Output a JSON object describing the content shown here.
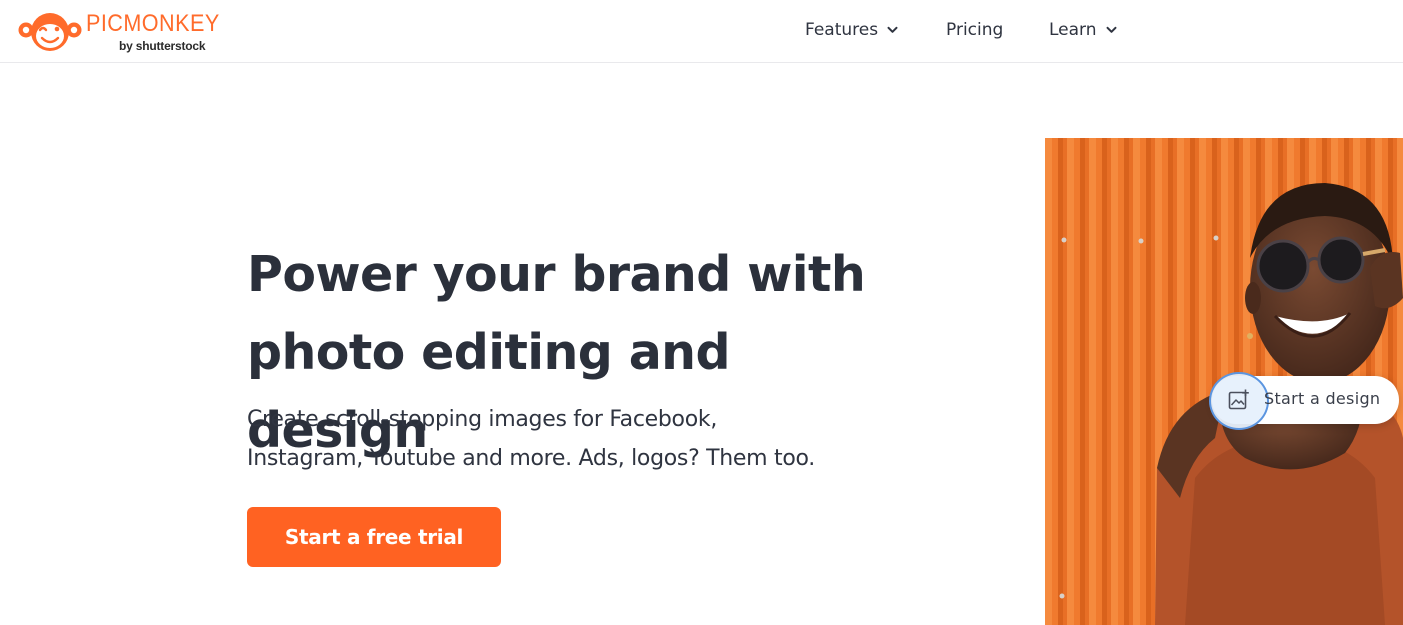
{
  "header": {
    "logo": {
      "wordmark": "PICMONKEY",
      "byline": "by shutterstock"
    },
    "nav": [
      {
        "label": "Features",
        "has_dropdown": true
      },
      {
        "label": "Pricing",
        "has_dropdown": false
      },
      {
        "label": "Learn",
        "has_dropdown": true
      }
    ]
  },
  "hero": {
    "title_line1": "Power your brand with",
    "title_line2": "photo editing and design",
    "subtitle_line1": "Create scroll-stopping images for Facebook,",
    "subtitle_line2": "Instagram, Youtube and more. Ads, logos? Them too.",
    "cta_label": "Start a free trial"
  },
  "hero_image": {
    "overlay_button_label": "Start a design",
    "overlay_icon": "image-add-icon"
  },
  "colors": {
    "brand_orange": "#ff6b2b",
    "cta_orange": "#ff6222",
    "text_dark": "#2b303b",
    "ring_blue": "#5b95e0"
  }
}
